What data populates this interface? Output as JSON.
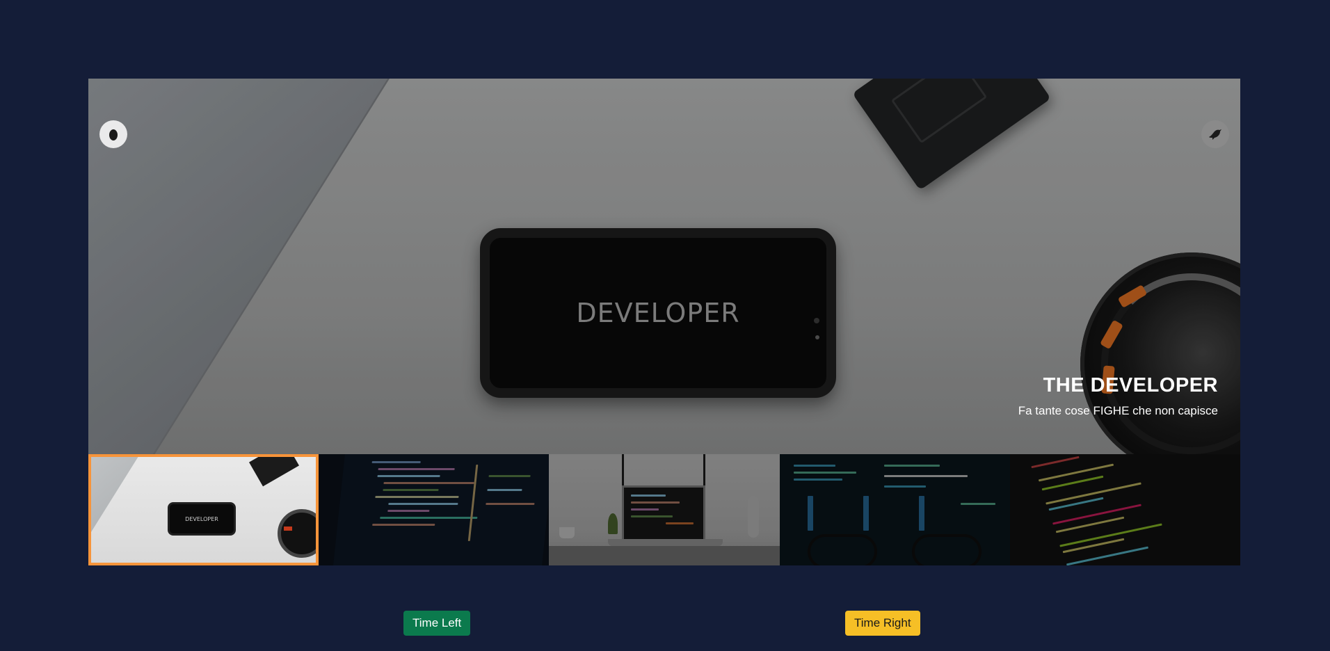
{
  "hero": {
    "phone_text": "DEVELOPER",
    "caption_title": "THE DEVELOPER",
    "caption_subtitle": "Fa tante cose FIGHE che non capisce"
  },
  "thumbnails": [
    {
      "label": "DEVELOPER",
      "active": true
    },
    {
      "label": "",
      "active": false
    },
    {
      "label": "",
      "active": false
    },
    {
      "label": "",
      "active": false
    },
    {
      "label": "",
      "active": false
    }
  ],
  "controls": {
    "prev_icon": "egg-icon",
    "next_icon": "bird-icon"
  },
  "buttons": {
    "time_left": "Time Left",
    "time_right": "Time Right"
  },
  "colors": {
    "background": "#141d38",
    "active_border": "#f7943a",
    "time_left_bg": "#0b7a4d",
    "time_right_bg": "#f6bf26"
  }
}
